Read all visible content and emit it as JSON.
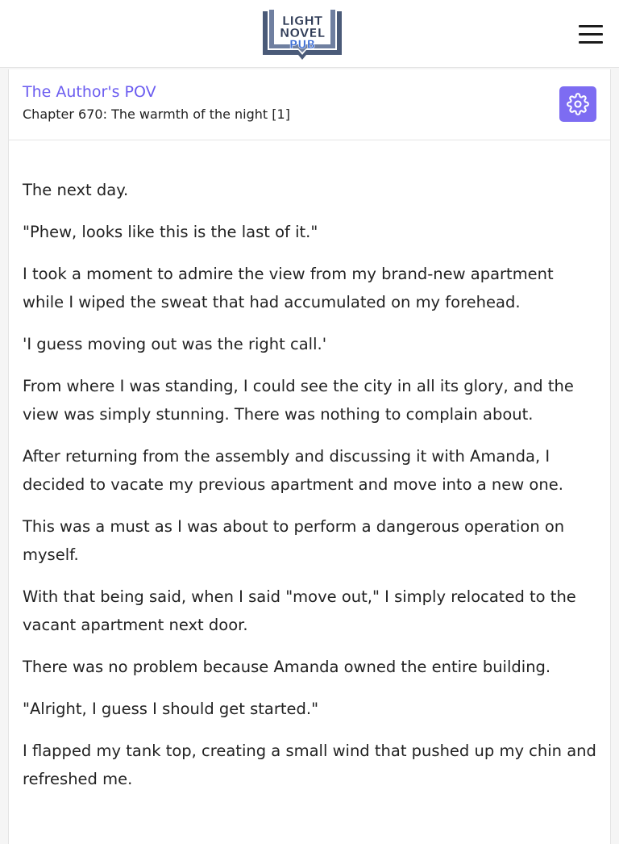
{
  "site": {
    "logo_text": [
      "LIGHT",
      "NOVEL",
      "PUB"
    ]
  },
  "header": {
    "novel_title": "The Author's POV",
    "chapter_title": "Chapter 670: The warmth of the night [1]"
  },
  "icons": {
    "menu": "hamburger-menu-icon",
    "settings": "gear-icon"
  },
  "colors": {
    "accent": "#7d6cf2",
    "link": "#6b5cf0",
    "text": "#222222"
  },
  "content": {
    "paragraphs": [
      "The next day.",
      "\"Phew, looks like this is the last of it.\"",
      "I took a moment to admire the view from my brand-new apartment while I wiped the sweat that had accumulated on my forehead.",
      "'I guess moving out was the right call.'",
      "From where I was standing, I could see the city in all its glory, and the view was simply stunning. There was nothing to complain about.",
      "After returning from the assembly and discussing it with Amanda, I decided to vacate my previous apartment and move into a new one.",
      "This was a must as I was about to perform a dangerous operation on myself.",
      "With that being said, when I said \"move out,\" I simply relocated to the vacant apartment next door.",
      "There was no problem because Amanda owned the entire building.",
      "\"Alright, I guess I should get started.\"",
      "I flapped my tank top, creating a small wind that pushed up my chin and refreshed me."
    ]
  }
}
